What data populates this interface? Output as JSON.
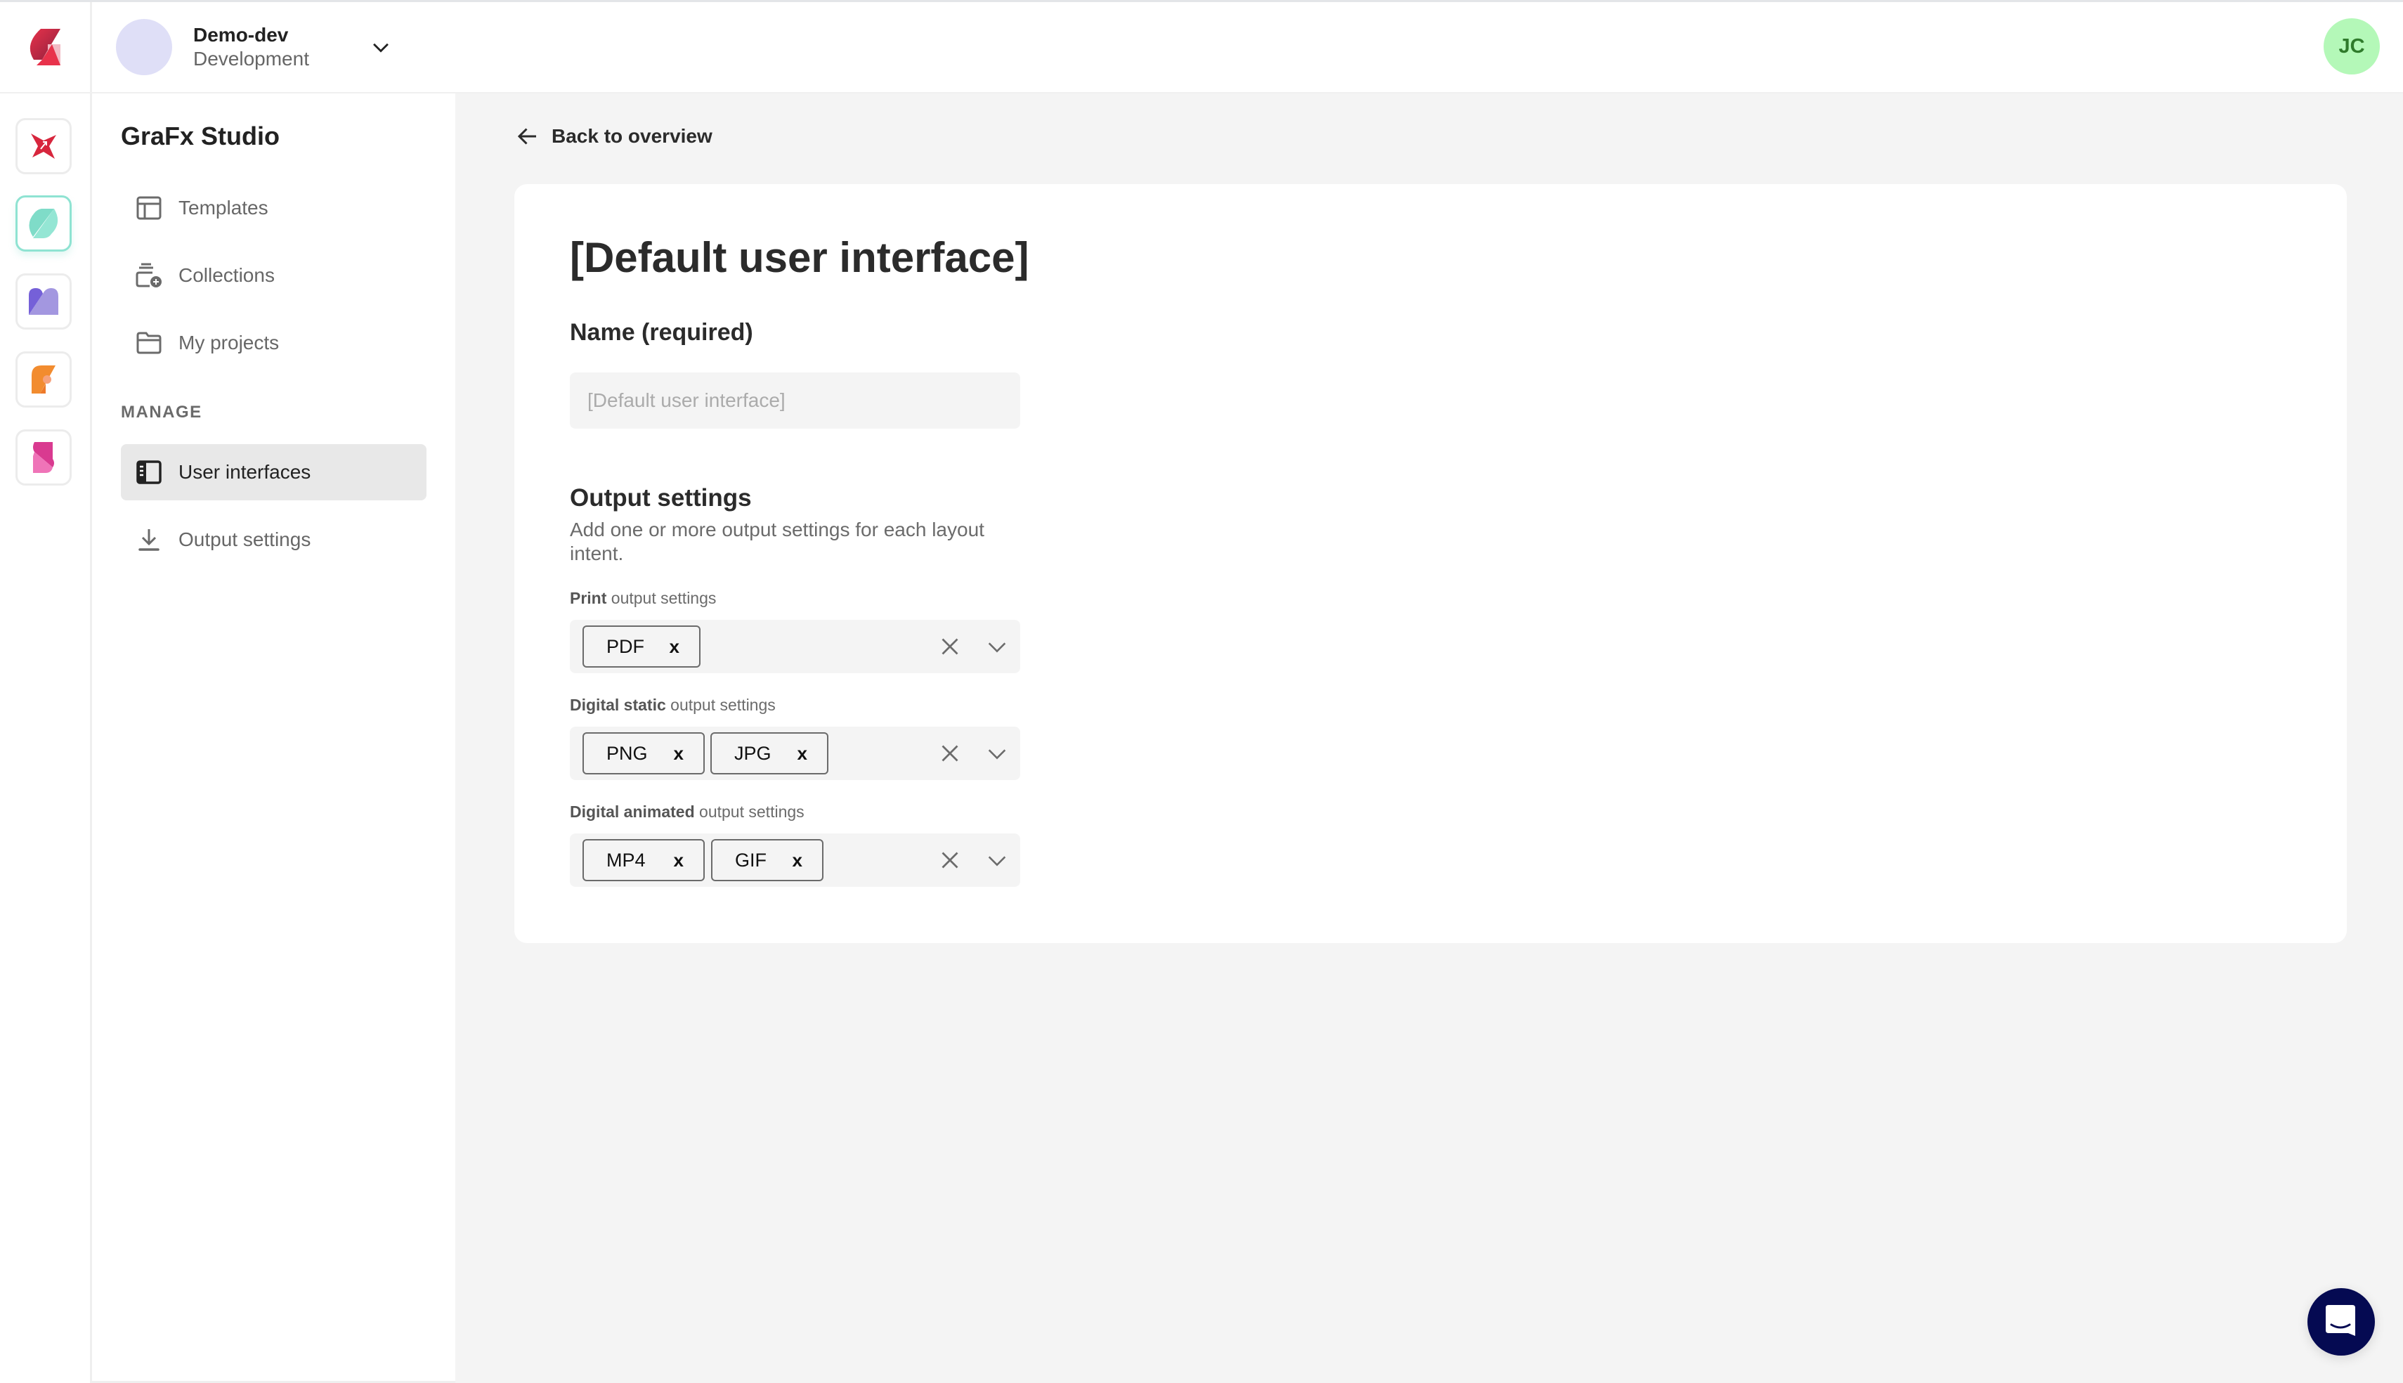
{
  "topbar": {
    "workspace_name": "Demo-dev",
    "workspace_env": "Development",
    "user_initials": "JC"
  },
  "apps": [
    {
      "name": "app-red-star"
    },
    {
      "name": "app-teal",
      "active": true
    },
    {
      "name": "app-purple"
    },
    {
      "name": "app-orange"
    },
    {
      "name": "app-pink"
    }
  ],
  "nav": {
    "title": "GraFx Studio",
    "items": [
      {
        "label": "Templates",
        "icon": "template-icon"
      },
      {
        "label": "Collections",
        "icon": "collections-icon"
      },
      {
        "label": "My projects",
        "icon": "folder-icon"
      }
    ],
    "manage_section": "MANAGE",
    "manage_items": [
      {
        "label": "User interfaces",
        "icon": "user-interface-icon",
        "active": true
      },
      {
        "label": "Output settings",
        "icon": "download-icon"
      }
    ]
  },
  "main": {
    "back_label": "Back to overview",
    "title": "[Default user interface]",
    "name_label": "Name (required)",
    "name_value": "",
    "name_placeholder": "[Default user interface]",
    "output_title": "Output settings",
    "output_desc": "Add one or more output settings for each layout intent.",
    "selects": [
      {
        "label_bold": "Print",
        "label_rest": " output settings",
        "chips": [
          "PDF"
        ]
      },
      {
        "label_bold": "Digital static",
        "label_rest": " output settings",
        "chips": [
          "PNG",
          "JPG"
        ]
      },
      {
        "label_bold": "Digital animated",
        "label_rest": " output settings",
        "chips": [
          "MP4",
          "GIF"
        ]
      }
    ],
    "chip_remove_glyph": "x"
  },
  "colors": {
    "accent_teal": "#8fe3d2",
    "user_avatar_bg": "#b4f8b8",
    "chat_button": "#050a52"
  }
}
